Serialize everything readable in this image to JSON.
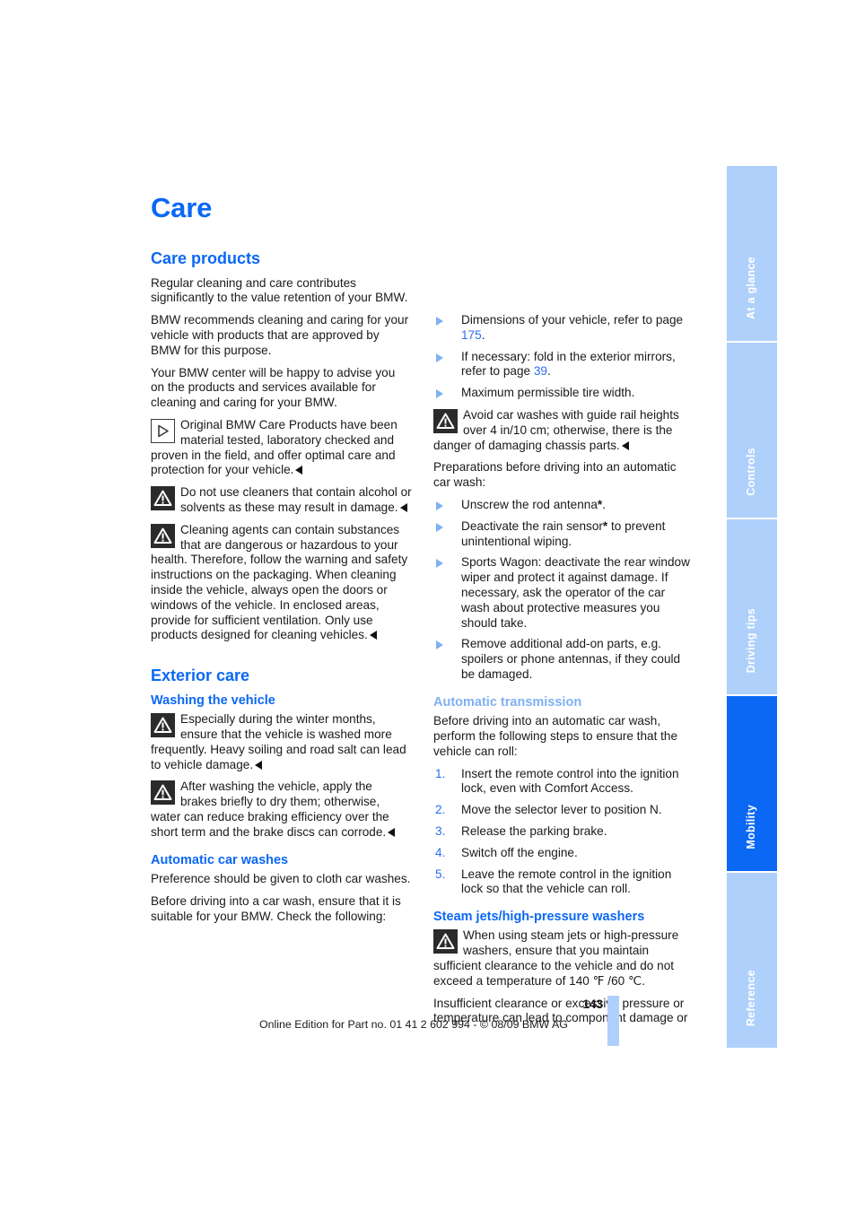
{
  "document": {
    "title": "Care",
    "page_number": "143",
    "footer_text": "Online Edition for Part no. 01 41 2 602 994 - © 08/09 BMW AG"
  },
  "sidebar": {
    "tabs": [
      {
        "label": "At a glance",
        "active": false
      },
      {
        "label": "Controls",
        "active": false
      },
      {
        "label": "Driving tips",
        "active": false
      },
      {
        "label": "Mobility",
        "active": true
      },
      {
        "label": "Reference",
        "active": false
      }
    ]
  },
  "left_column": {
    "section_heading": "Care products",
    "paragraphs": [
      "Regular cleaning and care contributes significantly to the value retention of your BMW.",
      "BMW recommends cleaning and caring for your vehicle with products that are approved by BMW for this purpose.",
      "Your BMW center will be happy to advise you on the products and services available for cleaning and caring for your BMW."
    ],
    "notes": [
      {
        "icon": "info-triangle-icon",
        "text": "Original BMW Care Products have been material tested, laboratory checked and proven in the field, and offer optimal care and protection for your vehicle."
      },
      {
        "icon": "warning-triangle-icon",
        "text": "Do not use cleaners that contain alcohol or solvents as these may result in damage."
      },
      {
        "icon": "warning-triangle-icon",
        "text": "Cleaning agents can contain substances that are dangerous or hazardous to your health. Therefore, follow the warning and safety instructions on the packaging. When cleaning inside the vehicle, always open the doors or windows of the vehicle. In enclosed areas, provide for sufficient ventilation. Only use products designed for cleaning vehicles."
      }
    ],
    "exterior_heading": "Exterior care",
    "washing_heading": "Washing the vehicle",
    "washing_notes": [
      {
        "icon": "warning-triangle-icon",
        "text": "Especially during the winter months, ensure that the vehicle is washed more frequently. Heavy soiling and road salt can lead to vehicle damage."
      },
      {
        "icon": "warning-triangle-icon",
        "text": "After washing the vehicle, apply the brakes briefly to dry them; otherwise, water can reduce braking efficiency over the short term and the brake discs can corrode."
      }
    ],
    "auto_wash_heading": "Automatic car washes",
    "auto_wash_paragraphs": [
      "Preference should be given to cloth car washes.",
      "Before driving into a car wash, ensure that it is suitable for your BMW. Check the following:"
    ]
  },
  "right_column": {
    "check_items": [
      {
        "pre": "Dimensions of your vehicle, refer to page ",
        "ref": "175",
        "post": "."
      },
      {
        "pre": "If necessary: fold in the exterior mirrors, refer to page ",
        "ref": "39",
        "post": "."
      },
      {
        "pre": "Maximum permissible tire width.",
        "ref": "",
        "post": ""
      }
    ],
    "guide_rail_note": {
      "icon": "warning-triangle-icon",
      "text": "Avoid car washes with guide rail heights over 4 in/10 cm; otherwise, there is the danger of damaging chassis parts."
    },
    "prep_intro": "Preparations before driving into an automatic car wash:",
    "prep_items": [
      {
        "pre": "Unscrew the rod antenna",
        "star": "*",
        "post": "."
      },
      {
        "pre": "Deactivate the rain sensor",
        "star": "*",
        "post": " to prevent unintentional wiping."
      },
      {
        "pre": "Sports Wagon: deactivate the rear window wiper and protect it against damage. If necessary, ask the operator of the car wash about protective measures you should take.",
        "star": "",
        "post": ""
      },
      {
        "pre": "Remove additional add-on parts, e.g. spoilers or phone antennas, if they could be damaged.",
        "star": "",
        "post": ""
      }
    ],
    "transmission_heading": "Automatic transmission",
    "transmission_intro": "Before driving into an automatic car wash, perform the following steps to ensure that the vehicle can roll:",
    "transmission_steps": [
      "Insert the remote control into the ignition lock, even with Comfort Access.",
      "Move the selector lever to position N.",
      "Release the parking brake.",
      "Switch off the engine.",
      "Leave the remote control in the ignition lock so that the vehicle can roll."
    ],
    "steam_heading": "Steam jets/high-pressure washers",
    "steam_note": {
      "icon": "warning-triangle-icon",
      "text": "When using steam jets or high-pressure washers, ensure that you maintain sufficient clearance to the vehicle and do not exceed a temperature of 140 ℉ /60 ℃."
    },
    "steam_continuation": "Insufficient clearance or excessive pressure or temperature can lead to component damage or"
  },
  "colors": {
    "heading_blue": "#0a68f5",
    "tab_inactive": "#aed0fb",
    "tab_active": "#0a68f5",
    "light_heading_blue": "#7fb0f2",
    "reference_blue": "#2a6ef0"
  }
}
